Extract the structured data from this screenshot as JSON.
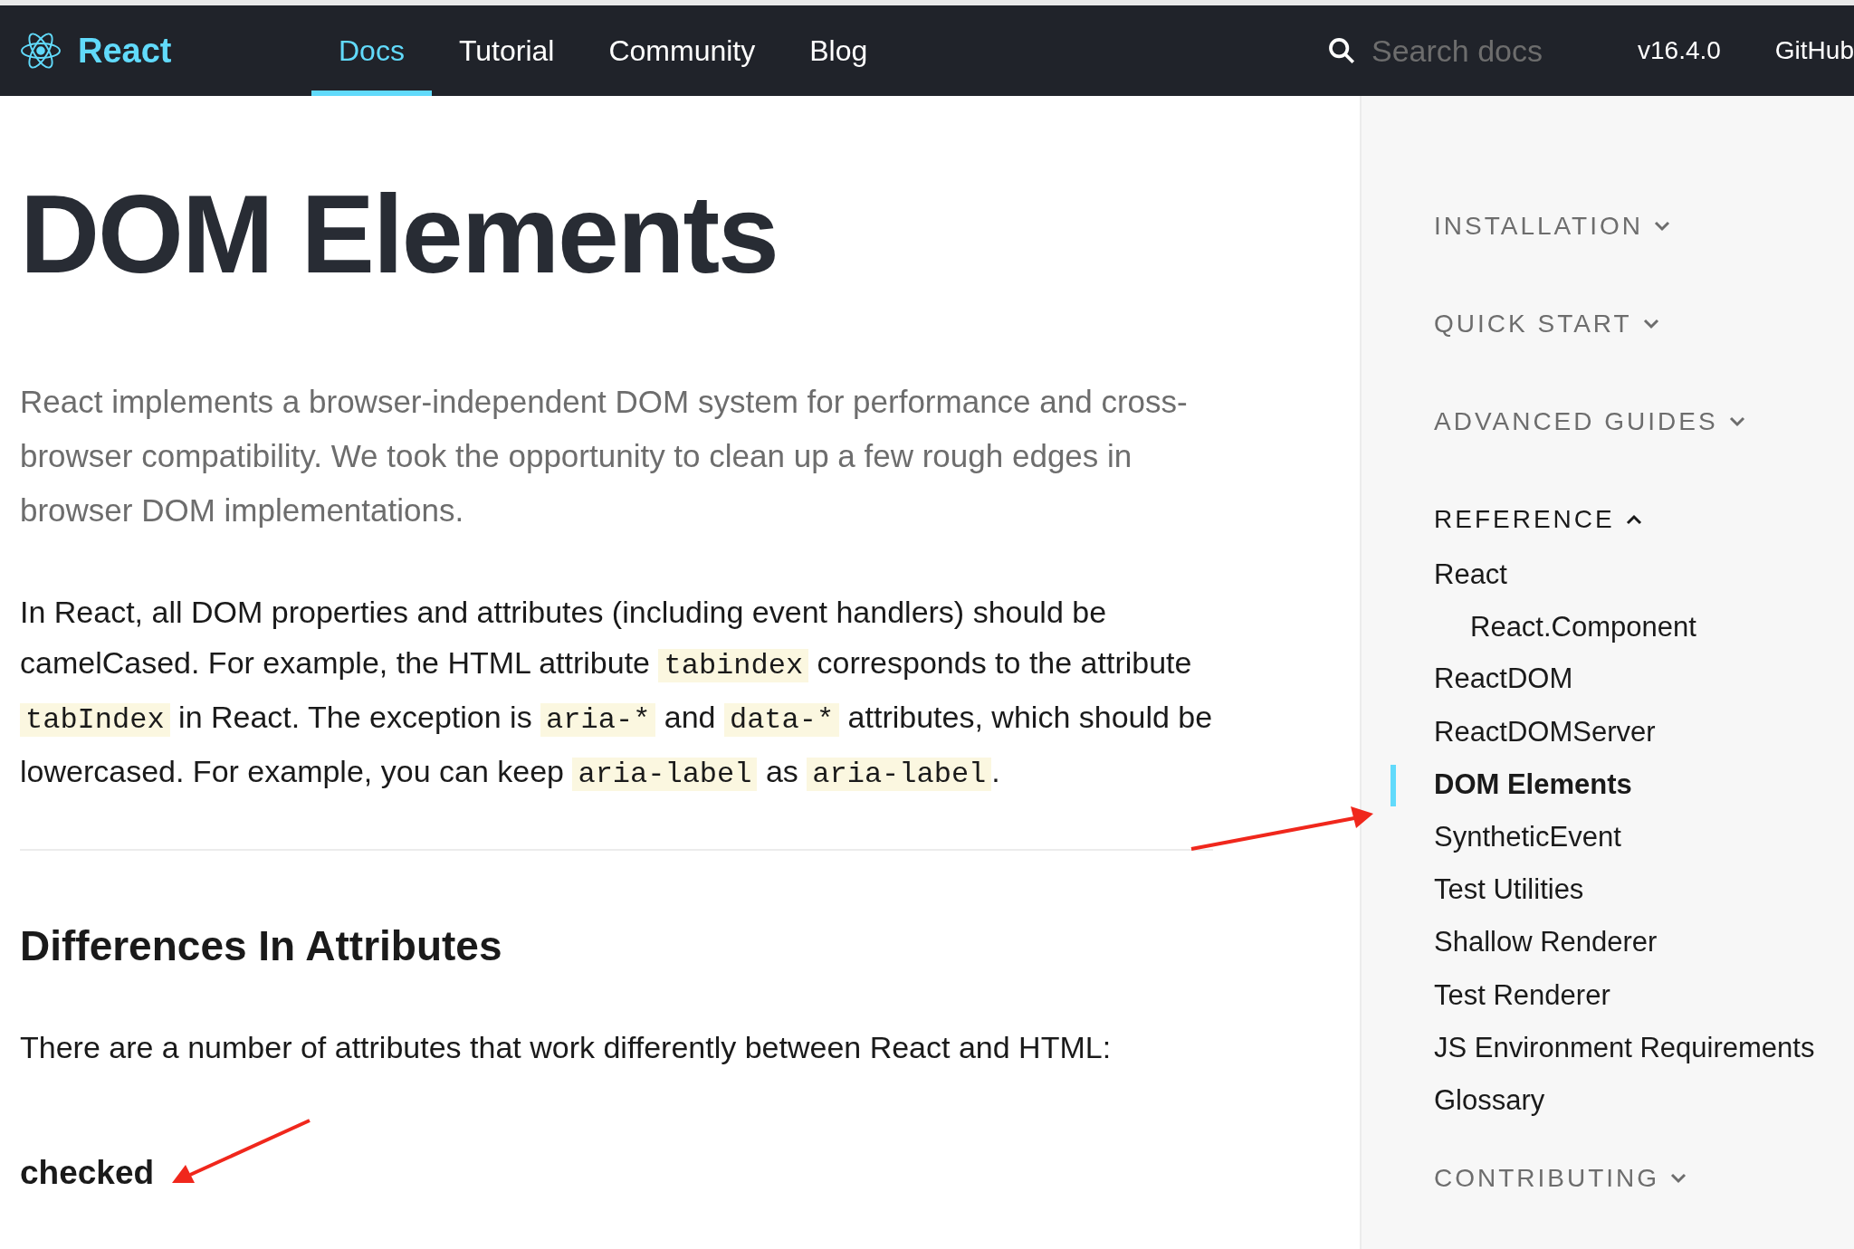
{
  "header": {
    "logo": "React",
    "nav": [
      {
        "label": "Docs",
        "selected": true
      },
      {
        "label": "Tutorial",
        "selected": false
      },
      {
        "label": "Community",
        "selected": false
      },
      {
        "label": "Blog",
        "selected": false
      }
    ],
    "search": {
      "placeholder": "Search docs"
    },
    "version": "v16.4.0",
    "github": "GitHub"
  },
  "article": {
    "title": "DOM Elements",
    "intro": "React implements a browser-independent DOM system for performance and cross-browser compatibility. We took the opportunity to clean up a few rough edges in browser DOM implementations.",
    "paragraph": [
      {
        "kind": "text",
        "text": "In React, all DOM properties and attributes (including event handlers) should be camelCased. For example, the HTML attribute "
      },
      {
        "kind": "code",
        "text": "tabindex"
      },
      {
        "kind": "text",
        "text": " corresponds to the attribute "
      },
      {
        "kind": "code",
        "text": "tabIndex"
      },
      {
        "kind": "text",
        "text": " in React. The exception is "
      },
      {
        "kind": "code",
        "text": "aria-*"
      },
      {
        "kind": "text",
        "text": " and "
      },
      {
        "kind": "code",
        "text": "data-*"
      },
      {
        "kind": "text",
        "text": " attributes, which should be lowercased. For example, you can keep "
      },
      {
        "kind": "code",
        "text": "aria-label"
      },
      {
        "kind": "text",
        "text": " as "
      },
      {
        "kind": "code",
        "text": "aria-label"
      },
      {
        "kind": "text",
        "text": "."
      }
    ],
    "heading": "Differences In Attributes",
    "sentence": "There are a number of attributes that work differently between React and HTML:",
    "subheading": "checked"
  },
  "sidebar": {
    "sections": [
      {
        "title": "INSTALLATION",
        "expanded": false
      },
      {
        "title": "QUICK START",
        "expanded": false
      },
      {
        "title": "ADVANCED GUIDES",
        "expanded": false
      },
      {
        "title": "REFERENCE",
        "expanded": true,
        "items": [
          {
            "label": "React",
            "selected": false,
            "children": [
              {
                "label": "React.Component",
                "selected": false
              }
            ]
          },
          {
            "label": "ReactDOM",
            "selected": false
          },
          {
            "label": "ReactDOMServer",
            "selected": false
          },
          {
            "label": "DOM Elements",
            "selected": true
          },
          {
            "label": "SyntheticEvent",
            "selected": false
          },
          {
            "label": "Test Utilities",
            "selected": false
          },
          {
            "label": "Shallow Renderer",
            "selected": false
          },
          {
            "label": "Test Renderer",
            "selected": false
          },
          {
            "label": "JS Environment Requirements",
            "selected": false
          },
          {
            "label": "Glossary",
            "selected": false
          }
        ]
      },
      {
        "title": "CONTRIBUTING",
        "expanded": false
      }
    ]
  }
}
